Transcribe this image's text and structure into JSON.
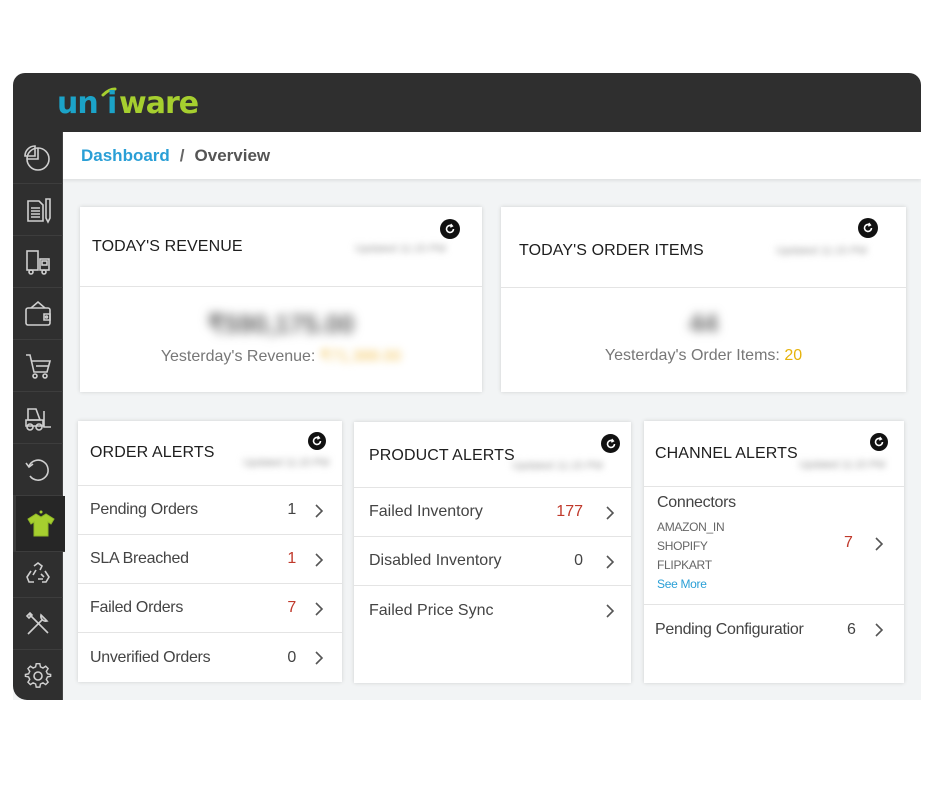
{
  "app": {
    "brand": "uniware",
    "brand_colors": {
      "primary_blue": "#1ba3c8",
      "primary_green": "#a6cf2f"
    }
  },
  "sidebar": {
    "items": [
      {
        "name": "dashboard",
        "icon": "pie-chart-icon",
        "active": false
      },
      {
        "name": "orders",
        "icon": "document-edit-icon",
        "active": false
      },
      {
        "name": "shipping",
        "icon": "truck-icon",
        "active": false
      },
      {
        "name": "payments",
        "icon": "wallet-icon",
        "active": false
      },
      {
        "name": "procurement",
        "icon": "cart-icon",
        "active": false
      },
      {
        "name": "warehouse",
        "icon": "forklift-icon",
        "active": false
      },
      {
        "name": "returns",
        "icon": "return-arrow-icon",
        "active": false
      },
      {
        "name": "products",
        "icon": "tshirt-icon",
        "active": true
      },
      {
        "name": "reconciliation",
        "icon": "recycle-icon",
        "active": false
      },
      {
        "name": "tools",
        "icon": "tools-icon",
        "active": false
      },
      {
        "name": "settings",
        "icon": "gear-icon",
        "active": false
      }
    ]
  },
  "breadcrumb": {
    "root": "Dashboard",
    "separator": "/",
    "current": "Overview"
  },
  "revenue_card": {
    "title": "TODAY'S REVENUE",
    "updated": "Updated 11:15 PM",
    "value": "₹590,175.00",
    "yesterday_label": "Yesterday's Revenue:",
    "yesterday_value": "₹71,388.00"
  },
  "order_items_card": {
    "title": "TODAY'S ORDER ITEMS",
    "updated": "Updated 11:15 PM",
    "value": "44",
    "yesterday_label": "Yesterday's Order Items:",
    "yesterday_value": "20"
  },
  "order_alerts": {
    "title": "ORDER ALERTS",
    "updated": "Updated 11:15 PM",
    "rows": [
      {
        "label": "Pending Orders",
        "count": "1",
        "highlight": false
      },
      {
        "label": "SLA Breached",
        "count": "1",
        "highlight": true
      },
      {
        "label": "Failed Orders",
        "count": "7",
        "highlight": true
      },
      {
        "label": "Unverified Orders",
        "count": "0",
        "highlight": false
      }
    ]
  },
  "product_alerts": {
    "title": "PRODUCT ALERTS",
    "updated": "Updated 11:15 PM",
    "rows": [
      {
        "label": "Failed Inventory",
        "count": "177",
        "highlight": true
      },
      {
        "label": "Disabled Inventory",
        "count": "0",
        "highlight": false
      },
      {
        "label": "Failed Price Sync",
        "count": "",
        "highlight": false
      }
    ]
  },
  "channel_alerts": {
    "title": "CHANNEL ALERTS",
    "updated": "Updated 11:15 PM",
    "connectors": {
      "label": "Connectors",
      "channels": [
        "AMAZON_IN",
        "SHOPIFY",
        "FLIPKART"
      ],
      "see_more": "See More",
      "count": "7"
    },
    "pending_configuration": {
      "label": "Pending Configuratior",
      "count": "6"
    }
  },
  "colors": {
    "alert_red": "#c0392b",
    "accent_yellow": "#e6b30c",
    "link_blue": "#2a9fd6",
    "sidebar_bg": "#2f2f2f"
  }
}
